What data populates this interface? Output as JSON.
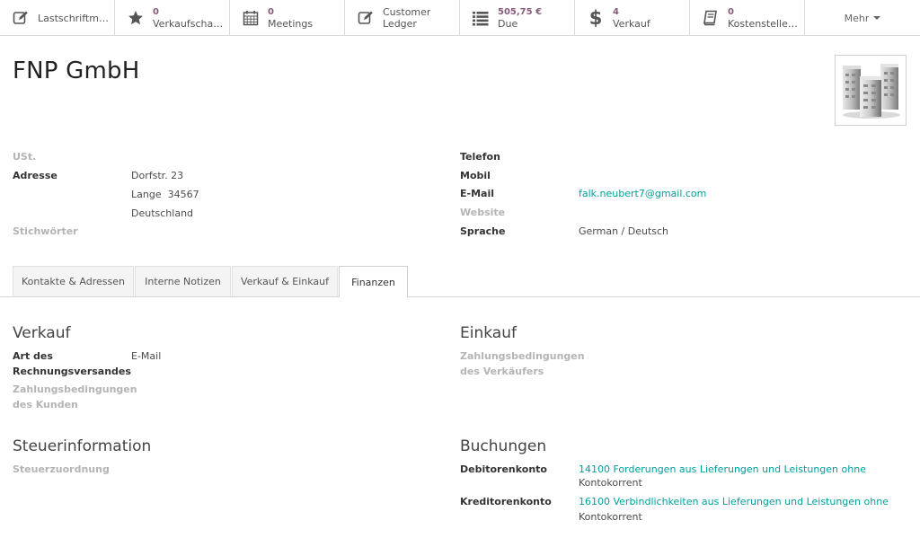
{
  "smart_buttons": [
    {
      "num": "",
      "label": "Lastschriftmandate"
    },
    {
      "num": "0",
      "label": "Verkaufschancen"
    },
    {
      "num": "0",
      "label": "Meetings"
    },
    {
      "num": "",
      "label": "Customer",
      "label2": "Ledger"
    },
    {
      "num": "505,75 €",
      "label": "Due"
    },
    {
      "num": "4",
      "label": "Verkauf"
    },
    {
      "num": "0",
      "label": "Kostenstellenkonten"
    },
    {
      "num": "",
      "label": "Mehr"
    }
  ],
  "record": {
    "title": "FNP GmbH"
  },
  "fields_left": {
    "vat_label": "USt.",
    "address_label": "Adresse",
    "street": "Dorfstr. 23",
    "city_zip": "Lange  34567",
    "country": "Deutschland",
    "tags_label": "Stichwörter"
  },
  "fields_right": {
    "phone_label": "Telefon",
    "mobile_label": "Mobil",
    "email_label": "E-Mail",
    "email_value": "falk.neubert7@gmail.com",
    "website_label": "Website",
    "language_label": "Sprache",
    "language_value": "German / Deutsch"
  },
  "tabs": [
    {
      "label": "Kontakte & Adressen",
      "active": false
    },
    {
      "label": "Interne Notizen",
      "active": false
    },
    {
      "label": "Verkauf & Einkauf",
      "active": false
    },
    {
      "label": "Finanzen",
      "active": true
    }
  ],
  "finance": {
    "sales_heading": "Verkauf",
    "invoice_method_label_1": "Art des",
    "invoice_method_label_2": "Rechnungsversandes",
    "invoice_method_value": "E-Mail",
    "customer_terms_label_1": "Zahlungsbedingungen",
    "customer_terms_label_2": "des Kunden",
    "purchase_heading": "Einkauf",
    "vendor_terms_label_1": "Zahlungsbedingungen",
    "vendor_terms_label_2": "des Verkäufers",
    "tax_heading": "Steuerinformation",
    "fiscal_position_label": "Steuerzuordnung",
    "accounting_heading": "Buchungen",
    "receivable_label": "Debitorenkonto",
    "receivable_value_1": "14100 Forderungen aus Lieferungen und Leistungen ohne",
    "receivable_value_2": "Kontokorrent",
    "payable_label": "Kreditorenkonto",
    "payable_value_1": "16100 Verbindlichkeiten aus Lieferungen und Leistungen ohne",
    "payable_value_2": "Kontokorrent"
  },
  "colors": {
    "accent": "#875a7b",
    "link": "#00a09d"
  }
}
